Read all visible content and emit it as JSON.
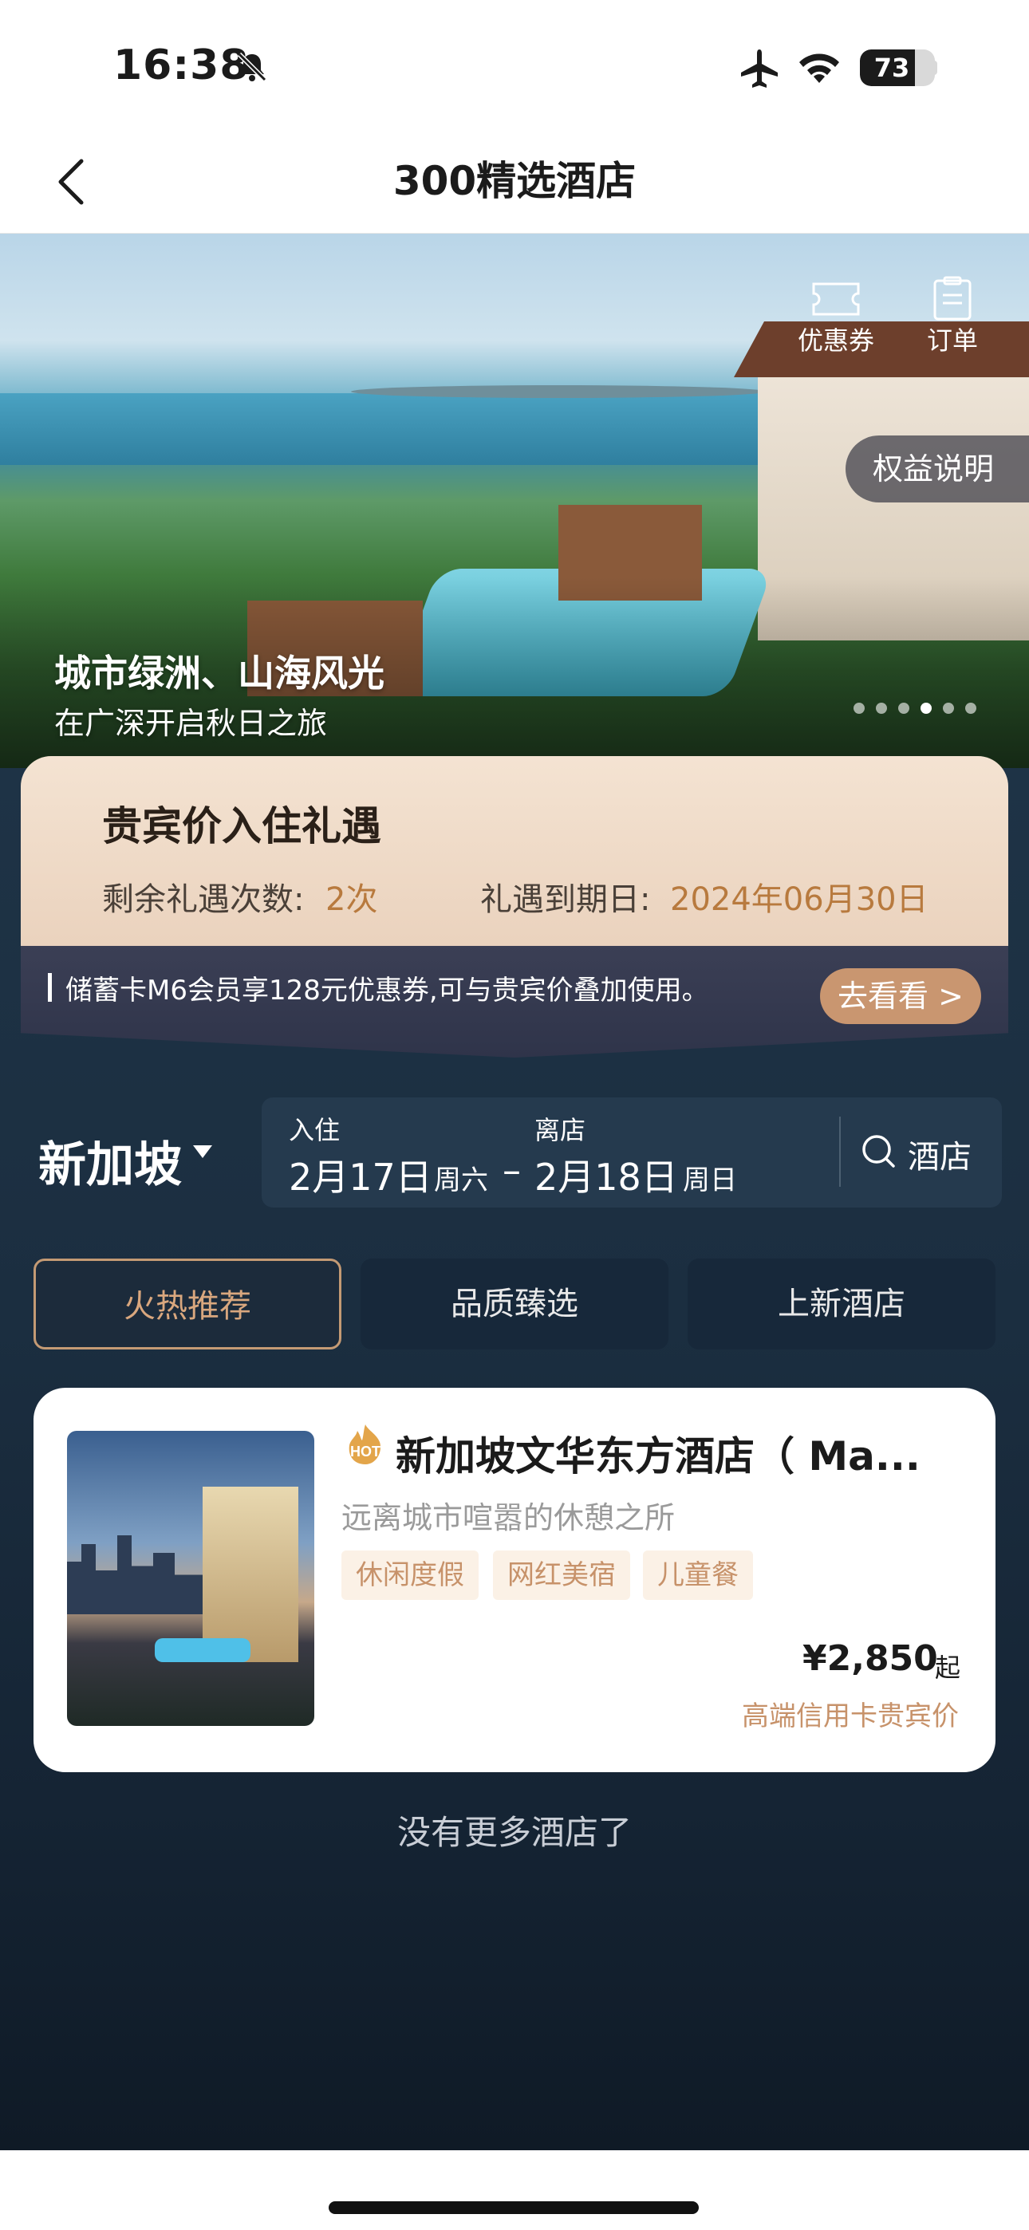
{
  "status_bar": {
    "time": "16:38",
    "battery": "73",
    "battery_level": 0.73
  },
  "nav": {
    "title": "300精选酒店"
  },
  "banner": {
    "coupon_label": "优惠券",
    "order_label": "订单",
    "benefit_button": "权益说明",
    "title": "城市绿洲、山海风光",
    "subtitle": "在广深开启秋日之旅",
    "slide_count": 6,
    "active_slide": 4
  },
  "gift": {
    "title": "贵宾价入住礼遇",
    "remain_label": "剩余礼遇次数:",
    "remain_value": "2次",
    "expiry_label": "礼遇到期日:",
    "expiry_value": "2024年06月30日"
  },
  "promo": {
    "text": "储蓄卡M6会员享128元优惠券,可与贵宾价叠加使用。",
    "button": "去看看 >"
  },
  "search": {
    "city": "新加坡",
    "checkin_label": "入住",
    "checkin_date": "2月17日",
    "checkin_weekday": "周六",
    "dash": "–",
    "checkout_label": "离店",
    "checkout_date": "2月18日",
    "checkout_weekday": "周日",
    "search_label": "酒店"
  },
  "tabs": [
    {
      "label": "火热推荐",
      "active": true
    },
    {
      "label": "品质臻选",
      "active": false
    },
    {
      "label": "上新酒店",
      "active": false
    }
  ],
  "hotel": {
    "badge": "HOT",
    "name": "新加坡文华东方酒店（ Ma...",
    "subtitle": "远离城市喧嚣的休憩之所",
    "tags": [
      "休闲度假",
      "网红美宿",
      "儿童餐"
    ],
    "price": "¥2,850",
    "price_suffix": "起",
    "price_note": "高端信用卡贵宾价"
  },
  "footer": {
    "no_more": "没有更多酒店了"
  },
  "colors": {
    "accent_gold": "#c7926a",
    "dark_bg": "#1b2e40",
    "gift_bg": "#f4e3d2"
  }
}
